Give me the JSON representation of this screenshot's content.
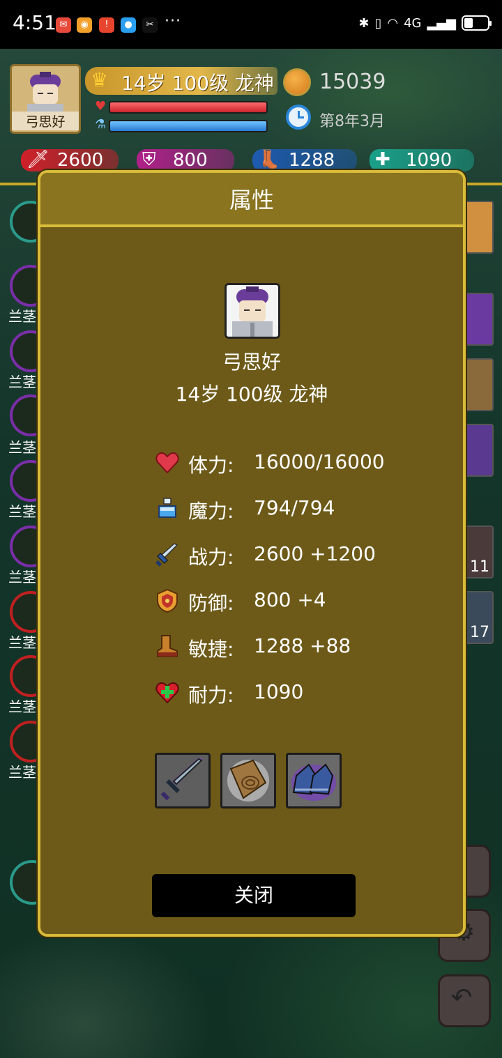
{
  "status_bar": {
    "time": "4:51",
    "more": "···",
    "network": "4G"
  },
  "hud": {
    "avatar_name": "弓思好",
    "level_text": "14岁 100级 龙神",
    "hp_fraction": 1.0,
    "mp_fraction": 1.0,
    "coins": "15039",
    "date": "第8年3月",
    "stats": {
      "attack": "2600",
      "defense": "800",
      "agility": "1288",
      "stamina": "1090"
    }
  },
  "side": {
    "left_label": "兰茎",
    "right_counts": [
      "11",
      "17"
    ]
  },
  "modal": {
    "title": "属性",
    "name": "弓思好",
    "level": "14岁 100级 龙神",
    "attributes": [
      {
        "icon": "heart-icon",
        "label": "体力:",
        "value": "16000/16000"
      },
      {
        "icon": "potion-icon",
        "label": "魔力:",
        "value": "794/794"
      },
      {
        "icon": "sword-icon",
        "label": "战力:",
        "value": "2600 +1200"
      },
      {
        "icon": "shield-icon",
        "label": "防御:",
        "value": "800 +4"
      },
      {
        "icon": "boot-icon",
        "label": "敏捷:",
        "value": "1288 +88"
      },
      {
        "icon": "heart-plus-icon",
        "label": "耐力:",
        "value": "1090"
      }
    ],
    "equipment": [
      "sword",
      "wood-shield",
      "boots"
    ],
    "close_label": "关闭"
  },
  "colors": {
    "modal_bg": "#6e5a18",
    "modal_border": "#d8bc3a",
    "hp": "#c8242c",
    "mp": "#2a7ad0"
  }
}
